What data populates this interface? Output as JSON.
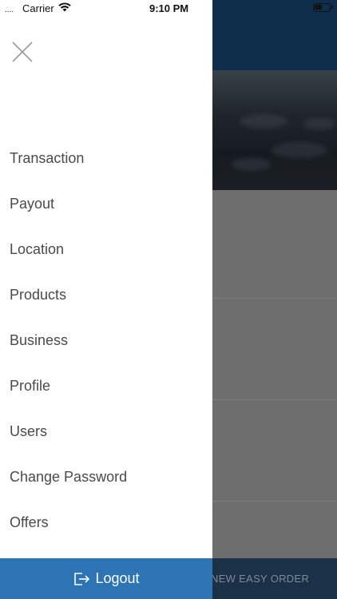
{
  "status_bar": {
    "signal": "....",
    "carrier": "Carrier",
    "time": "9:10 PM"
  },
  "drawer": {
    "close_icon": "close-icon",
    "menu_items": [
      {
        "label": "Transaction"
      },
      {
        "label": "Payout"
      },
      {
        "label": "Location"
      },
      {
        "label": "Products"
      },
      {
        "label": "Business"
      },
      {
        "label": "Profile"
      },
      {
        "label": "Users"
      },
      {
        "label": "Change Password"
      },
      {
        "label": "Offers"
      }
    ],
    "logout": {
      "label": "Logout",
      "icon": "logout-icon"
    }
  },
  "background": {
    "footer_label": "NEW EASY ORDER"
  },
  "colors": {
    "drawer_bg": "#ffffff",
    "logout_bg": "#2c74b3",
    "header_bg": "#0f2e4c",
    "menu_text": "#4a4a4a"
  }
}
